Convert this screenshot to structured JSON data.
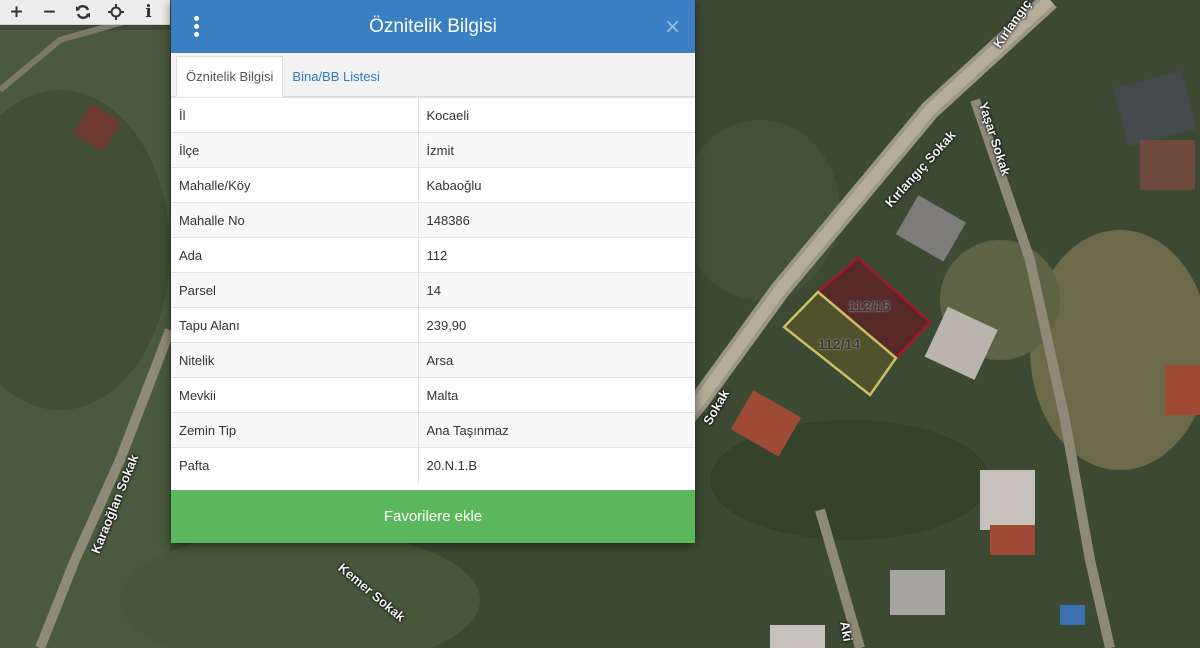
{
  "toolbar": {
    "zoom_in_glyph": "+",
    "zoom_out_glyph": "−",
    "info_glyph": "i"
  },
  "map": {
    "road_labels": [
      "Kırlangıç Sokak",
      "Yaşar Sokak",
      "Karaoğlan Sokak",
      "Kemer Sokak",
      "Sokak",
      "Kırlangıç",
      "Aki"
    ],
    "parcels": [
      {
        "label": "112/15",
        "stroke": "#a4162a",
        "fill": "#6e1020"
      },
      {
        "label": "112/14",
        "stroke": "#c7c065",
        "fill": "#5e5a22"
      }
    ]
  },
  "panel": {
    "title": "Öznitelik Bilgisi",
    "close_glyph": "×",
    "tabs": [
      "Öznitelik Bilgisi",
      "Bina/BB Listesi"
    ],
    "rows": [
      {
        "key": "İl",
        "value": "Kocaeli"
      },
      {
        "key": "İlçe",
        "value": "İzmit"
      },
      {
        "key": "Mahalle/Köy",
        "value": "Kabaoğlu"
      },
      {
        "key": "Mahalle No",
        "value": "148386"
      },
      {
        "key": "Ada",
        "value": "112"
      },
      {
        "key": "Parsel",
        "value": "14"
      },
      {
        "key": "Tapu Alanı",
        "value": "239,90"
      },
      {
        "key": "Nitelik",
        "value": "Arsa"
      },
      {
        "key": "Mevkii",
        "value": "Malta"
      },
      {
        "key": "Zemin Tip",
        "value": "Ana Taşınmaz"
      },
      {
        "key": "Pafta",
        "value": "20.N.1.B"
      }
    ],
    "favorite_label": "Favorilere ekle"
  },
  "colors": {
    "header": "#3a7fc1",
    "favorite_button": "#5cb85c",
    "tab_link": "#2f7bc4"
  }
}
